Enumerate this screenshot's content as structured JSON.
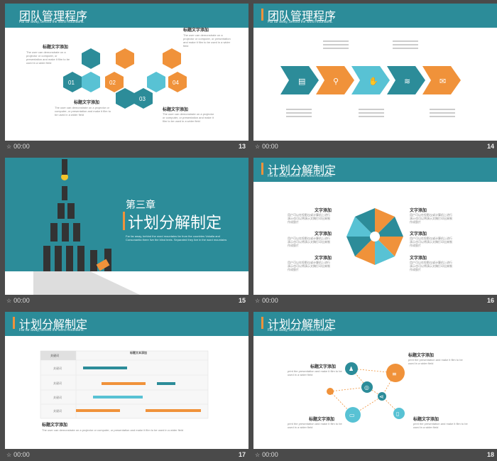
{
  "slides": [
    {
      "num": "13",
      "title": "团队管理程序",
      "subtitle": "Far far away, behind the word mountains.",
      "hex_labels": [
        "01",
        "02",
        "03",
        "04"
      ],
      "items": [
        {
          "heading": "标题文字添加",
          "body": "The user can demonstrate on a projector or computer, or presentation and make it film to be used in a wider field"
        },
        {
          "heading": "标题文字添加",
          "body": "The user can demonstrate on a projector or computer, or presentation and make it film to be used in a wider field"
        },
        {
          "heading": "标题文字添加",
          "body": "The user can demonstrate on a projector or computer, or presentation and make it film to be used in a wider field"
        },
        {
          "heading": "标题文字添加",
          "body": "The user can demonstrate on a projector or computer, or presentation and make it film to be used in a wider field"
        }
      ]
    },
    {
      "num": "14",
      "title": "团队管理程序",
      "subtitle": "Far far away, behind the word mountains.",
      "arrow_icons": [
        "chart-icon",
        "search-icon",
        "thumbs-up-icon",
        "wifi-icon",
        "chat-icon"
      ]
    },
    {
      "num": "15",
      "chapter": "第三章",
      "title": "计划分解制定",
      "subtitle": "Far far away, behind the word mountains far from the countries Vokalia and Consonantia there live the blind texts. Separated they live in the word mountains"
    },
    {
      "num": "16",
      "title": "计划分解制定",
      "subtitle": "Far far away, behind the word mountains.",
      "items": [
        {
          "heading": "文字添加",
          "body": "用户可以在投影仪或计算机上进行演示也可以将演示文稿打印出来制作成胶片"
        },
        {
          "heading": "文字添加",
          "body": "用户可以在投影仪或计算机上进行演示也可以将演示文稿打印出来制作成胶片"
        },
        {
          "heading": "文字添加",
          "body": "用户可以在投影仪或计算机上进行演示也可以将演示文稿打印出来制作成胶片"
        },
        {
          "heading": "文字添加",
          "body": "用户可以在投影仪或计算机上进行演示也可以将演示文稿打印出来制作成胶片"
        },
        {
          "heading": "文字添加",
          "body": "用户可以在投影仪或计算机上进行演示也可以将演示文稿打印出来制作成胶片"
        },
        {
          "heading": "文字添加",
          "body": "用户可以在投影仪或计算机上进行演示也可以将演示文稿打印出来制作成胶片"
        }
      ]
    },
    {
      "num": "17",
      "title": "计划分解制定",
      "subtitle": "Far far away, behind the word mountains.",
      "table_header_left": "关键词",
      "table_header_right": "标题文本添加",
      "rows": [
        "关键词",
        "关键词",
        "关键词",
        "关键词"
      ],
      "footer_heading": "标题文字添加",
      "footer_body": "The user can demonstrate on a projector or computer, or presentation and make it film to be used in a wider field"
    },
    {
      "num": "18",
      "title": "计划分解制定",
      "subtitle": "Far far away, behind the word mountains.",
      "items": [
        {
          "heading": "标题文字添加",
          "body": "print the presentation and make it film to be used in a wider field"
        },
        {
          "heading": "标题文字添加",
          "body": "print the presentation and make it film to be used in a wider field"
        },
        {
          "heading": "标题文字添加",
          "body": "print the presentation and make it film to be used in a wider field"
        },
        {
          "heading": "标题文字添加",
          "body": "print the presentation and make it film to be used in a wider field"
        }
      ]
    }
  ],
  "time_label": "00:00",
  "colors": {
    "teal": "#2c8c99",
    "orange": "#f0923a",
    "cyan": "#58c2d4",
    "dark": "#4a4a4a"
  }
}
